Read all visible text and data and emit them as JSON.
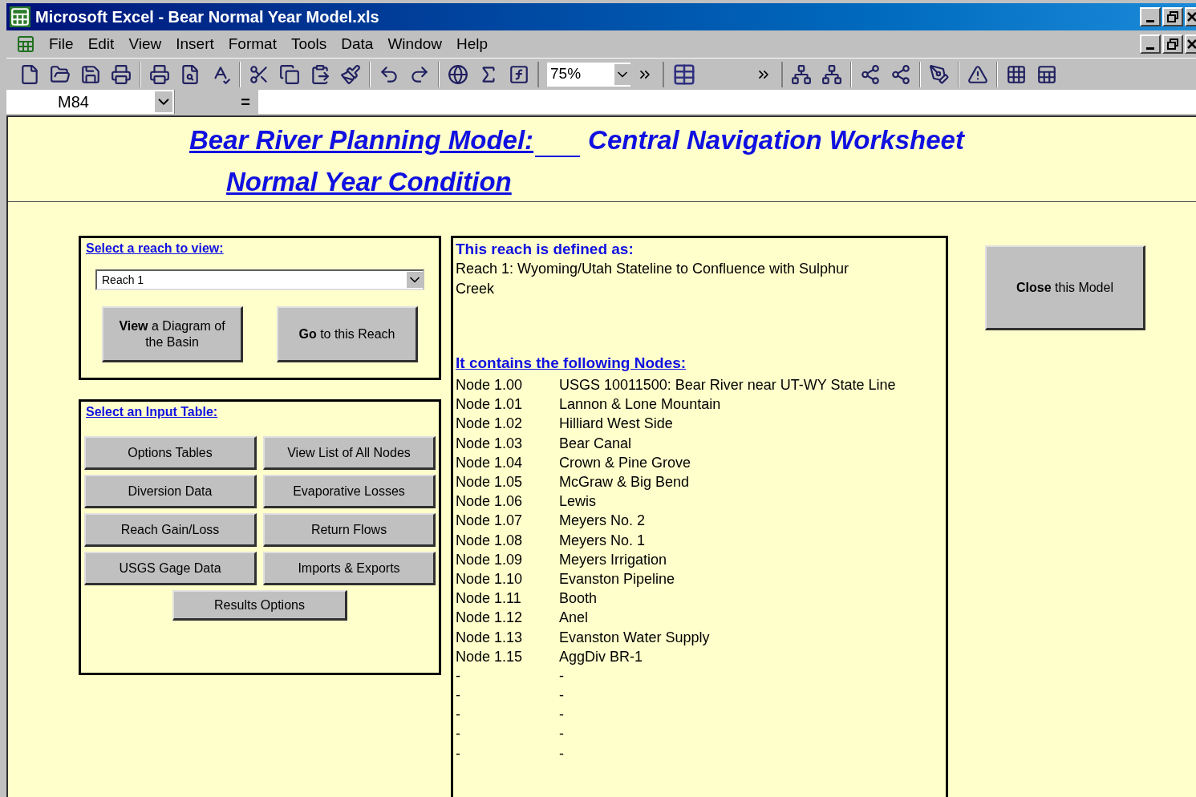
{
  "window": {
    "title": "Microsoft Excel - Bear Normal Year Model.xls"
  },
  "menu": [
    "File",
    "Edit",
    "View",
    "Insert",
    "Format",
    "Tools",
    "Data",
    "Window",
    "Help"
  ],
  "toolbar": {
    "zoom": "75%"
  },
  "formula_bar": {
    "name_box": "M84",
    "equals": "="
  },
  "sheet": {
    "title_line_1": "Bear River Planning Model:",
    "title_line_1_right": "Central Navigation Worksheet",
    "title_line_2": "Normal Year Condition",
    "reach_panel": {
      "heading": "Select a reach to view:",
      "dropdown": "Reach 1",
      "buttons": [
        "**View** a Diagram of the Basin",
        "**Go** to this Reach"
      ]
    },
    "input_panel": {
      "heading": "Select an Input Table:",
      "buttons": [
        "Options Tables",
        "View List of All Nodes",
        "Diversion Data",
        "Evaporative Losses",
        "Reach Gain/Loss",
        "Return Flows",
        "USGS Gage Data",
        "Imports & Exports"
      ],
      "last_button": "Results Options"
    },
    "definition": {
      "heading": "This reach is defined as:",
      "text": "Reach 1:  Wyoming/Utah Stateline to Confluence with Sulphur Creek",
      "nodes_heading": "It contains the following Nodes:",
      "nodes": [
        {
          "id": "Node 1.00",
          "name": "USGS 10011500:  Bear River near UT-WY State Line"
        },
        {
          "id": "Node 1.01",
          "name": "Lannon & Lone Mountain"
        },
        {
          "id": "Node 1.02",
          "name": "Hilliard West Side"
        },
        {
          "id": "Node 1.03",
          "name": "Bear Canal"
        },
        {
          "id": "Node 1.04",
          "name": "Crown & Pine Grove"
        },
        {
          "id": "Node 1.05",
          "name": "McGraw & Big Bend"
        },
        {
          "id": "Node 1.06",
          "name": "Lewis"
        },
        {
          "id": "Node 1.07",
          "name": "Meyers No. 2"
        },
        {
          "id": "Node 1.08",
          "name": "Meyers No. 1"
        },
        {
          "id": "Node 1.09",
          "name": "Meyers Irrigation"
        },
        {
          "id": "Node 1.10",
          "name": "Evanston Pipeline"
        },
        {
          "id": "Node 1.11",
          "name": "Booth"
        },
        {
          "id": "Node 1.12",
          "name": "Anel"
        },
        {
          "id": "Node 1.13",
          "name": "Evanston Water Supply"
        },
        {
          "id": "Node 1.15",
          "name": "AggDiv BR-1"
        },
        {
          "id": "-",
          "name": "-"
        },
        {
          "id": "-",
          "name": "-"
        },
        {
          "id": "-",
          "name": "-"
        },
        {
          "id": "-",
          "name": "-"
        },
        {
          "id": "-",
          "name": "-"
        }
      ]
    },
    "close_button": "**Close** this Model"
  }
}
